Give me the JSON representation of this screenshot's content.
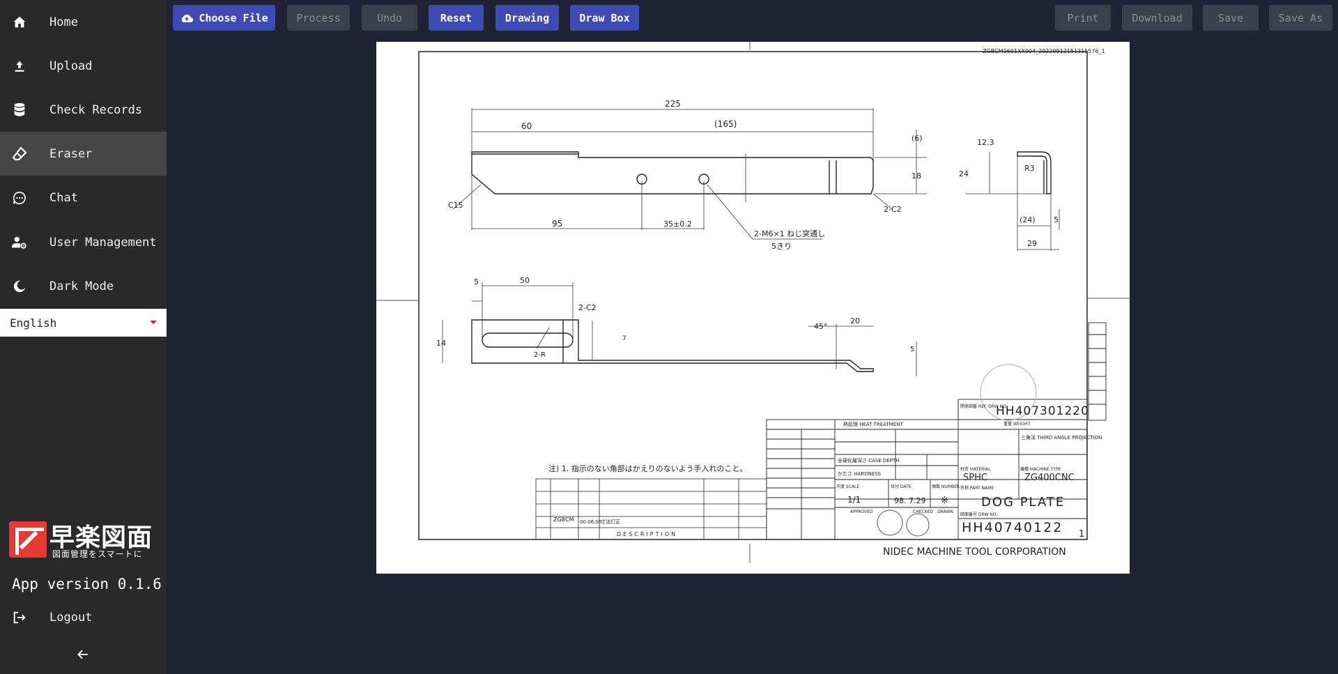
{
  "sidebar": {
    "items": [
      {
        "label": "Home",
        "icon": "home-icon"
      },
      {
        "label": "Upload",
        "icon": "upload-icon"
      },
      {
        "label": "Check Records",
        "icon": "database-icon"
      },
      {
        "label": "Eraser",
        "icon": "eraser-icon",
        "active": true
      },
      {
        "label": "Chat",
        "icon": "chat-icon"
      },
      {
        "label": "User Management",
        "icon": "user-settings-icon"
      },
      {
        "label": "Dark Mode",
        "icon": "moon-icon"
      }
    ],
    "language": "English",
    "logo_title": "早楽図面",
    "logo_subtitle": "図面管理をスマートに",
    "version": "App version 0.1.6",
    "logout_label": "Logout"
  },
  "toolbar": {
    "choose_file": "Choose File",
    "process": "Process",
    "undo": "Undo",
    "reset": "Reset",
    "drawing": "Drawing",
    "draw_box": "Draw Box",
    "print": "Print",
    "download": "Download",
    "save": "Save",
    "save_as": "Save As"
  },
  "drawing": {
    "file_id": "ZGBCM1601XX004_20220912151315576_1",
    "dims": {
      "d225": "225",
      "d60": "60",
      "d165": "(165)",
      "d95": "95",
      "d35": "35±0.2",
      "d6": "(6)",
      "d18": "18",
      "d123": "12.3",
      "d24": "24",
      "dR3": "R3",
      "d24b": "(24)",
      "d5": "5",
      "d29": "29",
      "c15": "C15",
      "c2": "2-C2",
      "m6": "2-M6×1 ねじ突通し",
      "kiri": "5きり",
      "d5b": "5",
      "d50": "50",
      "c2b": "2-C2",
      "d14": "14",
      "r2": "2-R",
      "d45": "45°",
      "d20": "20",
      "d5c": "5",
      "d7": "7"
    },
    "note": "注) 1. 指示のない角部はかえりのないよう手入れのこと。",
    "title_block": {
      "ref_drw_no": "HH407301220",
      "ref_label": "関係図番 REF. DRW NO.",
      "weight_label": "重量 WEIGHT",
      "projection": "三角法 THIRD ANGLE PROJECTION",
      "heat_treatment": "熱処理 HEAT TREATMENT",
      "case_depth": "全硬化層深さ CASE DEPTH",
      "hardness": "かたさ HARDNESS",
      "material_label": "材質 MATERIAL",
      "material": "SPHC",
      "machine_label": "機種 MACHINE TYPE",
      "machine": "ZG400CNC",
      "scale_label": "尺度 SCALE",
      "scale": "1/1",
      "date_label": "日付 DATE",
      "date": "98. 7.29",
      "number_label": "個数 NUMBER",
      "number": "※",
      "part_name_label": "名称 PART NAME",
      "part_name": "DOG PLATE",
      "drw_no_label": "図面番号 DRW NO.",
      "drw_no": "HH40740122",
      "sheet": "1",
      "rev_no": "ZGBCM",
      "rev_date": "00.06.06",
      "rev_desc": "寸法訂正",
      "description_label": "DESCRIPTION",
      "company": "NIDEC MACHINE TOOL CORPORATION",
      "approved": "APPROVED",
      "checked": "CHECKED",
      "drawn": "DRAWN"
    }
  }
}
